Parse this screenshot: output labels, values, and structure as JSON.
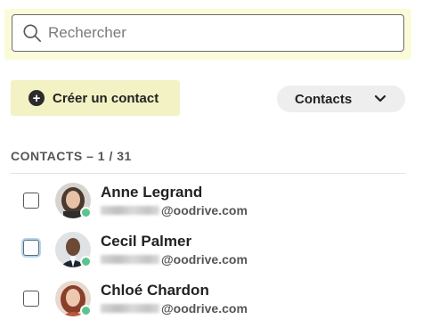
{
  "search": {
    "placeholder": "Rechercher",
    "value": ""
  },
  "toolbar": {
    "create_label": "Créer un contact",
    "filter_label": "Contacts"
  },
  "section": {
    "header": "CONTACTS – 1 / 31"
  },
  "contacts": [
    {
      "name": "Anne Legrand",
      "email_domain": "@oodrive.com",
      "checked": false,
      "online": true
    },
    {
      "name": "Cecil Palmer",
      "email_domain": "@oodrive.com",
      "checked": false,
      "online": true
    },
    {
      "name": "Chloé Chardon",
      "email_domain": "@oodrive.com",
      "checked": false,
      "online": true
    }
  ],
  "colors": {
    "accent_bg": "#f2f2c4",
    "search_bg": "#fbfbd9",
    "presence": "#5cc48d"
  }
}
